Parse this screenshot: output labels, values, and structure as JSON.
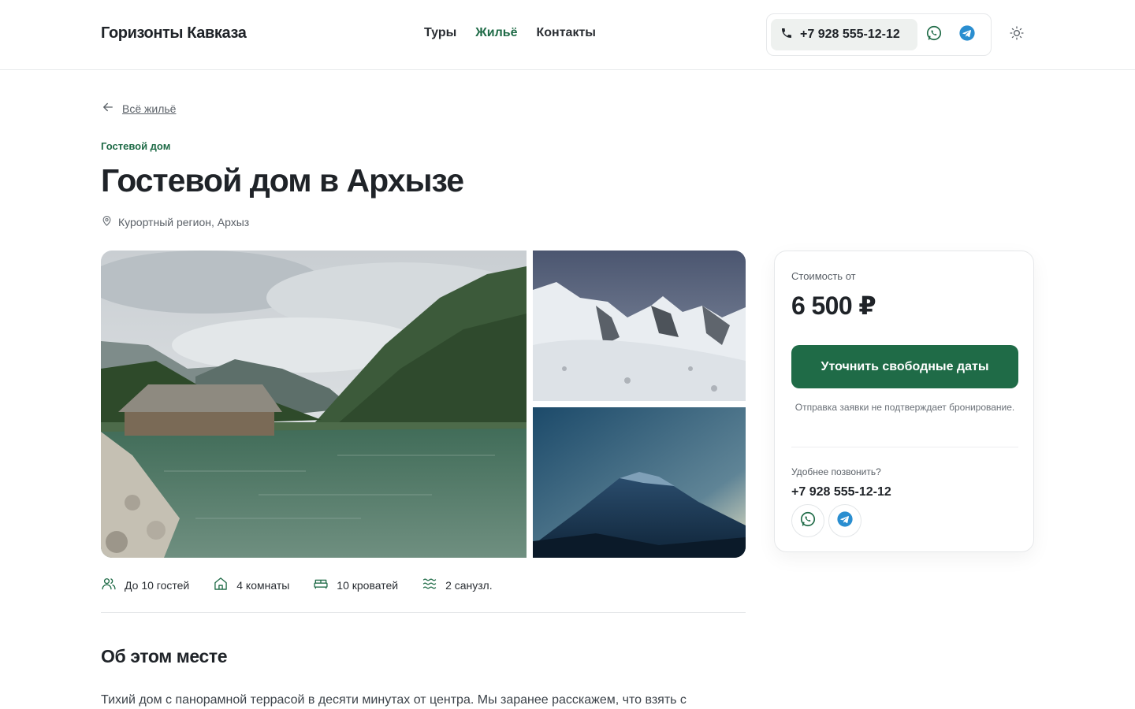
{
  "header": {
    "logo": "Горизонты Кавказа",
    "nav": [
      {
        "label": "Туры",
        "active": false
      },
      {
        "label": "Жильё",
        "active": true
      },
      {
        "label": "Контакты",
        "active": false
      }
    ],
    "phone": "+7 928 555-12-12",
    "icons": [
      "phone-icon",
      "whatsapp-icon",
      "telegram-icon",
      "sun-icon"
    ]
  },
  "breadcrumb": {
    "back_label": "Всё жильё"
  },
  "property": {
    "kind": "Гостевой дом",
    "title": "Гостевой дом в Архызе",
    "location": "Курортный регион, Архыз"
  },
  "amenities": [
    {
      "icon": "users-icon",
      "label": "До 10 гостей"
    },
    {
      "icon": "home-icon",
      "label": "4 комнаты"
    },
    {
      "icon": "bed-icon",
      "label": "10 кроватей"
    },
    {
      "icon": "bath-icon",
      "label": "2 санузл."
    }
  ],
  "about": {
    "heading": "Об этом месте",
    "text": "Тихий дом с панорамной террасой в десяти минутах от центра. Мы заранее расскажем, что взять с"
  },
  "booking": {
    "price_label": "Стоимость от",
    "price": "6 500 ₽",
    "cta": "Уточнить свободные даты",
    "note": "Отправка заявки не подтверждает бронирование.",
    "call_label": "Удобнее позвонить?",
    "phone": "+7 928 555-12-12"
  },
  "colors": {
    "accent": "#1f6b47",
    "whatsapp": "#1f6b47",
    "telegram": "#2a8ed0"
  }
}
